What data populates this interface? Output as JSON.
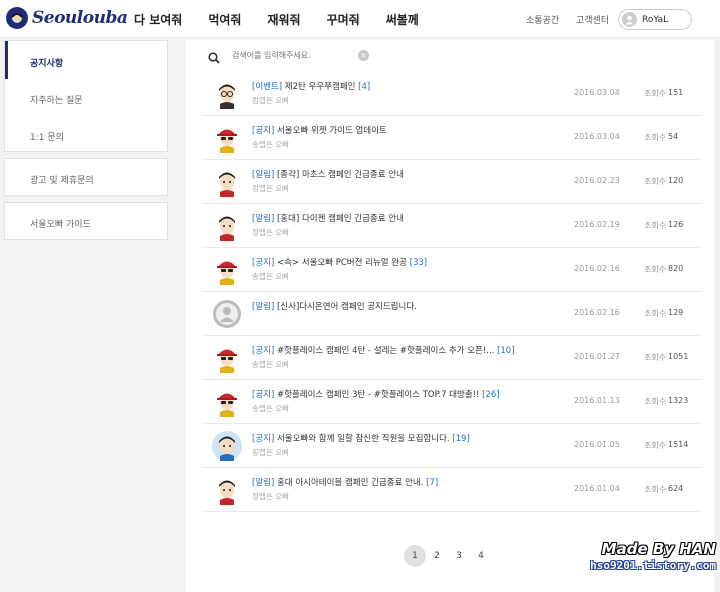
{
  "header": {
    "logo_text": "Seoulouba",
    "nav": [
      "다 보여줘",
      "먹여줘",
      "재워줘",
      "꾸며줘",
      "써볼께"
    ],
    "util_community": "소통공간",
    "util_support": "고객센터",
    "user_name": "RoYaL"
  },
  "sidebar": {
    "group1": [
      "공지사항",
      "자주하는 질문",
      "1:1 문의"
    ],
    "ad_inquiry": "광고 및 제휴문의",
    "guide": "서울오빠 가이드"
  },
  "search": {
    "placeholder": "검색어를 입력해주세요."
  },
  "view_label": "조회수",
  "posts": [
    {
      "category": "[이벤트]",
      "title": "제2탄 우우쭈캠페인",
      "count": "[4]",
      "author": "컴캡은 오빠",
      "date": "2016.03.04",
      "views": "151",
      "avatar": "glasses"
    },
    {
      "category": "[공지]",
      "title": "서울오빠 위젯 가이드 업데이트",
      "count": "",
      "author": "송맵은 오빠",
      "date": "2016.03.04",
      "views": "54",
      "avatar": "cap"
    },
    {
      "category": "[알림]",
      "title": "[종각] 마초스 캠페인 긴급종료 안내",
      "count": "",
      "author": "정맵은 오빠",
      "date": "2016.02.23",
      "views": "120",
      "avatar": "dark"
    },
    {
      "category": "[알림]",
      "title": "[홍대] 다이젠 캠페인 긴급종료 안내",
      "count": "",
      "author": "정맵은 오빠",
      "date": "2016.02.19",
      "views": "126",
      "avatar": "dark"
    },
    {
      "category": "[공지]",
      "title": "<속> 서울오빠 PC버전 리뉴얼 완공",
      "count": "[33]",
      "author": "송맵은 오빠",
      "date": "2016.02.16",
      "views": "820",
      "avatar": "cap"
    },
    {
      "category": "[알림]",
      "title": "[신사]다시온연어 캠페인 공지드립니다.",
      "count": "",
      "author": "",
      "date": "2016.02.16",
      "views": "129",
      "avatar": "grey"
    },
    {
      "category": "[공지]",
      "title": "#핫플레이스 캠페인 4탄 - 설레는 #핫플레이스 추가 오픈!...",
      "count": "[10]",
      "author": "송맵은 오빠",
      "date": "2016.01.27",
      "views": "1051",
      "avatar": "cap"
    },
    {
      "category": "[공지]",
      "title": "#핫플레이스 캠페인 3탄 - #핫플레이스 TOP.7 대방출!!",
      "count": "[26]",
      "author": "송맵은 오빠",
      "date": "2016.01.13",
      "views": "1323",
      "avatar": "cap"
    },
    {
      "category": "[공지]",
      "title": "서울오빠와 함께 일할 참신한 직원을 모집합니다.",
      "count": "[19]",
      "author": "꽁맵은 오빠",
      "date": "2016.01.05",
      "views": "1514",
      "avatar": "blue"
    },
    {
      "category": "[알림]",
      "title": "홍대 아시아테이블 캠페인 긴급종료 안내.",
      "count": "[7]",
      "author": "정맵은 오빠",
      "date": "2016.01.04",
      "views": "624",
      "avatar": "dark"
    }
  ],
  "pagination": {
    "pages": [
      "1",
      "2",
      "3",
      "4"
    ],
    "current": 0
  },
  "watermark": {
    "line1": "Made By HAN",
    "line2": "hso9201.tistory.com"
  }
}
